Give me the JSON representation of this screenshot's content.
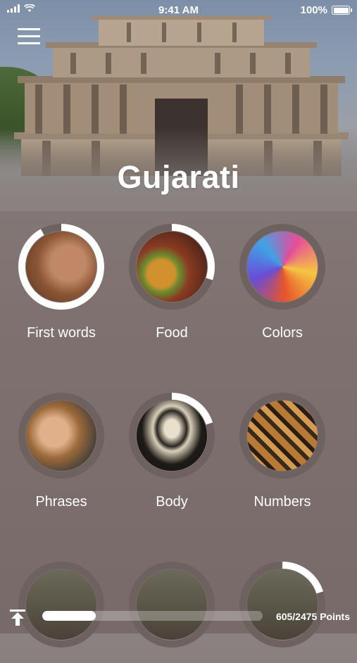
{
  "status_bar": {
    "time": "9:41 AM",
    "battery": "100%"
  },
  "title": "Gujarati",
  "categories": [
    {
      "label": "First words",
      "icon": "baby-face-photo",
      "progress": 0.92
    },
    {
      "label": "Food",
      "icon": "burger-food-photo",
      "progress": 0.3
    },
    {
      "label": "Colors",
      "icon": "color-powder-photo",
      "progress": 0
    },
    {
      "label": "Phrases",
      "icon": "smiling-woman-photo",
      "progress": 0
    },
    {
      "label": "Body",
      "icon": "skeleton-photo",
      "progress": 0.2
    },
    {
      "label": "Numbers",
      "icon": "wooden-numbers-photo",
      "progress": 0
    },
    {
      "label": "",
      "icon": "category-photo",
      "progress": 0
    },
    {
      "label": "",
      "icon": "category-photo",
      "progress": 0
    },
    {
      "label": "",
      "icon": "category-photo",
      "progress": 0.2
    }
  ],
  "footer": {
    "points_text": "605/2475 Points",
    "progress": 0.244
  },
  "colors": {
    "ring_track": "#6e6260",
    "ring_progress": "#ffffff",
    "accent": "#ffffff"
  }
}
